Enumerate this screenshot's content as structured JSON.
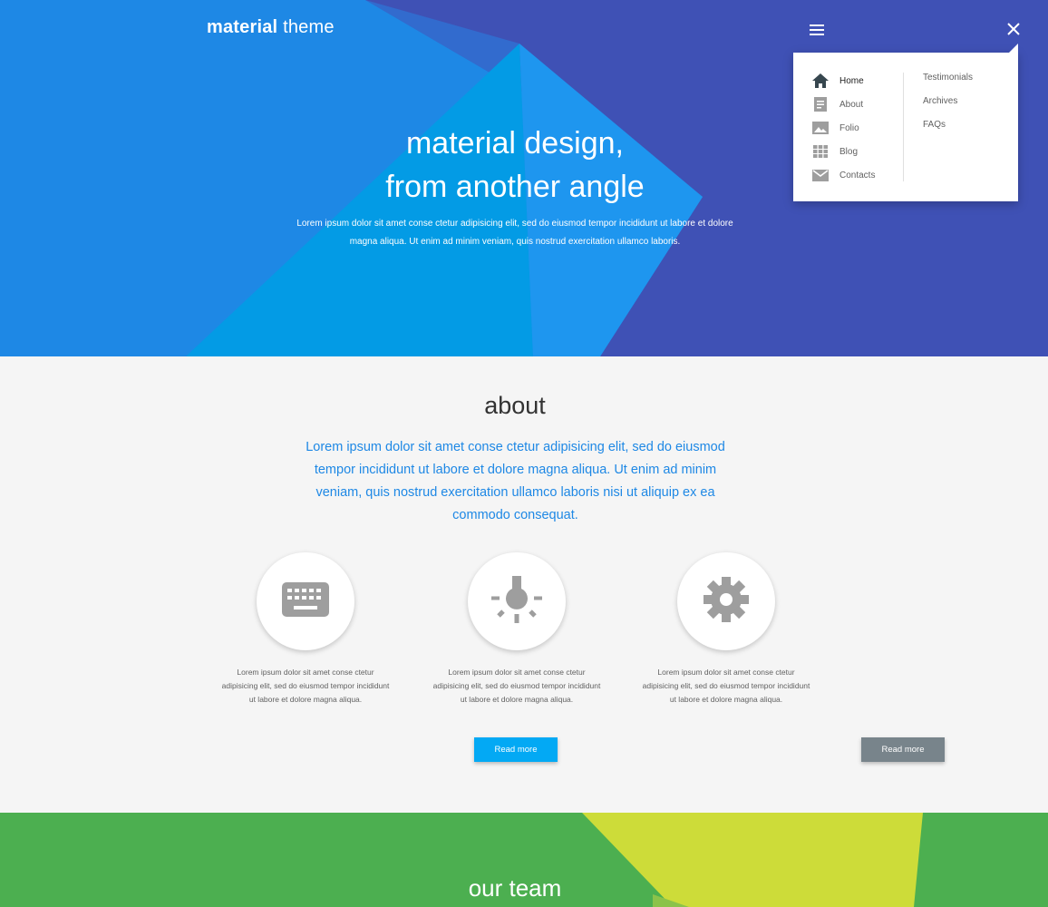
{
  "colors": {
    "hero_blue": "#1e88e5",
    "hero_indigo": "#3f51b5",
    "accent_blue": "#03a9f4",
    "team_green": "#4caf50",
    "team_lime": "#cddc39",
    "button_grey": "#78848b"
  },
  "header": {
    "brand_bold": "material",
    "brand_light": "theme",
    "menu_icon": "menu-icon",
    "close_icon": "close-icon"
  },
  "hero": {
    "title_line1": "material design,",
    "title_line2": "from another angle",
    "subtitle": "Lorem ipsum dolor sit amet conse ctetur adipisicing elit, sed do eiusmod tempor incididunt ut labore et dolore magna aliqua. Ut enim ad minim veniam, quis nostrud exercitation ullamco laboris."
  },
  "menu": {
    "left": [
      {
        "label": "Home",
        "icon": "home-icon",
        "active": true
      },
      {
        "label": "About",
        "icon": "document-icon"
      },
      {
        "label": "Folio",
        "icon": "image-icon"
      },
      {
        "label": "Blog",
        "icon": "grid-icon"
      },
      {
        "label": "Contacts",
        "icon": "mail-icon"
      }
    ],
    "right": [
      "Testimonials",
      "Archives",
      "FAQs"
    ]
  },
  "about": {
    "title": "about",
    "lead": "Lorem ipsum dolor sit amet conse ctetur adipisicing elit, sed do eiusmod tempor incididunt ut labore et dolore magna aliqua. Ut enim ad minim veniam, quis nostrud exercitation ullamco laboris nisi ut aliquip ex ea commodo consequat.",
    "features": [
      {
        "icon": "keyboard-icon",
        "text": "Lorem ipsum dolor sit amet conse ctetur adipisicing elit, sed do eiusmod tempor incididunt ut labore et dolore magna aliqua."
      },
      {
        "icon": "lightbulb-icon",
        "text": "Lorem ipsum dolor sit amet conse ctetur adipisicing elit, sed do eiusmod tempor incididunt ut labore et dolore magna aliqua."
      },
      {
        "icon": "gear-icon",
        "text": "Lorem ipsum dolor sit amet conse ctetur adipisicing elit, sed do eiusmod tempor incididunt ut labore et dolore magna aliqua."
      }
    ],
    "button_primary": "Read more",
    "button_secondary": "Read more"
  },
  "team": {
    "title": "our team"
  }
}
